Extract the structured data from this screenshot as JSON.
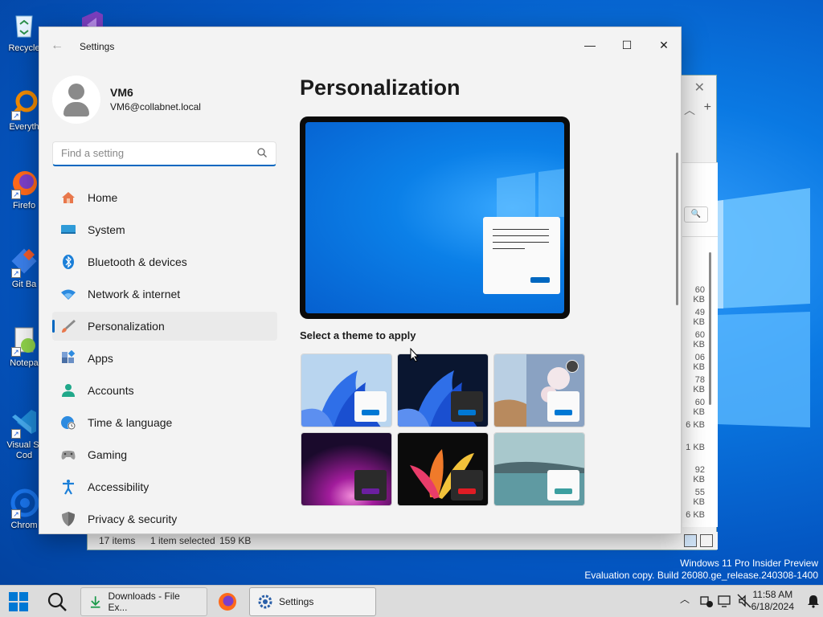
{
  "desktop": {
    "icons": [
      {
        "label": "Recycle"
      },
      {
        "label": "Everyth"
      },
      {
        "label": "Firefo"
      },
      {
        "label": "Git Ba"
      },
      {
        "label": "Notepa"
      },
      {
        "label": "Visual St Cod"
      },
      {
        "label": "Chrom"
      }
    ],
    "watermark_line1": "Windows 11 Pro Insider Preview",
    "watermark_line2": "Evaluation copy. Build 26080.ge_release.240308-1400"
  },
  "explorer": {
    "sizes": [
      "60 KB",
      "49 KB",
      "60 KB",
      "06 KB",
      "78 KB",
      "60 KB",
      "6 KB",
      "1 KB",
      "92 KB",
      "55 KB",
      "6 KB"
    ],
    "status_items": "17 items",
    "status_selected": "1 item selected",
    "status_size": "159 KB"
  },
  "settings": {
    "window_title": "Settings",
    "user": {
      "name": "VM6",
      "email": "VM6@collabnet.local"
    },
    "search_placeholder": "Find a setting",
    "nav": [
      {
        "label": "Home",
        "icon": "home-icon"
      },
      {
        "label": "System",
        "icon": "system-icon"
      },
      {
        "label": "Bluetooth & devices",
        "icon": "bluetooth-icon"
      },
      {
        "label": "Network & internet",
        "icon": "wifi-icon"
      },
      {
        "label": "Personalization",
        "icon": "brush-icon",
        "selected": true
      },
      {
        "label": "Apps",
        "icon": "apps-icon"
      },
      {
        "label": "Accounts",
        "icon": "accounts-icon"
      },
      {
        "label": "Time & language",
        "icon": "globe-clock-icon"
      },
      {
        "label": "Gaming",
        "icon": "gamepad-icon"
      },
      {
        "label": "Accessibility",
        "icon": "accessibility-icon"
      },
      {
        "label": "Privacy & security",
        "icon": "shield-icon"
      }
    ],
    "page_title": "Personalization",
    "theme_heading": "Select a theme to apply",
    "themes": [
      {
        "name": "windows-light",
        "accent": "#0078d4"
      },
      {
        "name": "windows-dark",
        "accent": "#0078d4"
      },
      {
        "name": "spotlight",
        "accent": "#0078d4"
      },
      {
        "name": "glow",
        "accent": "#6b1fa0"
      },
      {
        "name": "captured-motion",
        "accent": "#e01c24"
      },
      {
        "name": "flow",
        "accent": "#3c9fa0"
      }
    ]
  },
  "taskbar": {
    "apps": [
      {
        "label": "Downloads - File Ex..."
      },
      {
        "label": "Settings"
      }
    ],
    "time": "11:58 AM",
    "date": "6/18/2024"
  },
  "colors": {
    "accent": "#0067c0"
  }
}
